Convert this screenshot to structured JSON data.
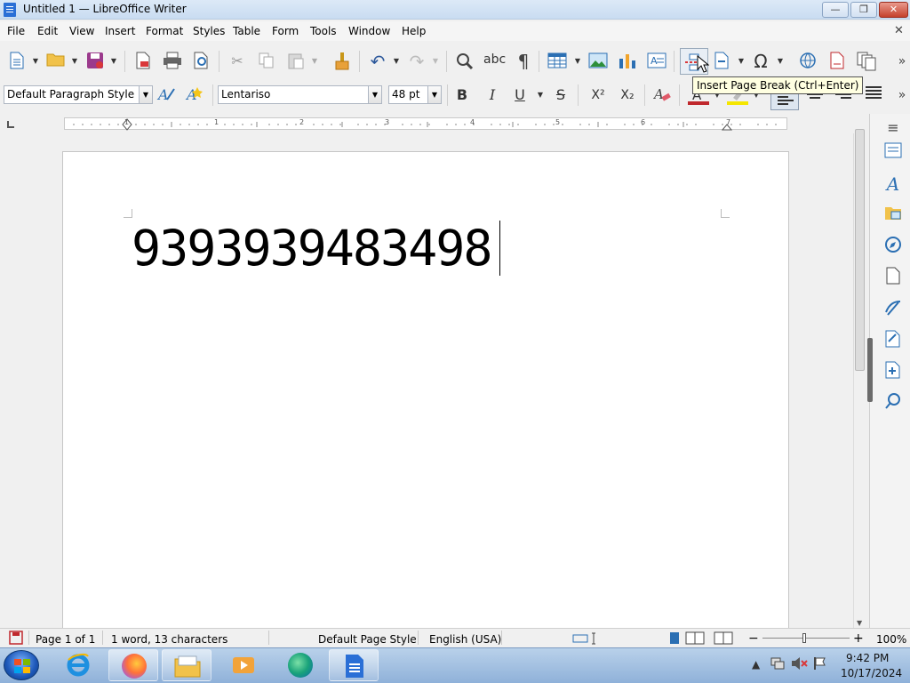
{
  "window": {
    "title": "Untitled 1 — LibreOffice Writer",
    "controls": {
      "minimize": "—",
      "maximize": "❐",
      "close": "✕"
    }
  },
  "menu": {
    "items": [
      "File",
      "Edit",
      "View",
      "Insert",
      "Format",
      "Styles",
      "Table",
      "Form",
      "Tools",
      "Window",
      "Help"
    ],
    "doc_close": "✕"
  },
  "formatting": {
    "paragraph_style": "Default Paragraph Style",
    "font_name": "Lentariso",
    "font_size": "48 pt",
    "bold": "B",
    "italic": "I",
    "underline": "U",
    "strikethrough": "S",
    "superscript": "X²",
    "subscript": "X₂",
    "font_color": "#c0282d",
    "highlight_color": "#f5e600"
  },
  "tooltip": "Insert Page Break (Ctrl+Enter)",
  "ruler": {
    "numbers": [
      "1",
      "1",
      "2",
      "3",
      "4",
      "5",
      "6",
      "7"
    ]
  },
  "document": {
    "text": "9393939483498"
  },
  "statusbar": {
    "page": "Page 1 of 1",
    "words": "1 word, 13 characters",
    "page_style": "Default Page Style",
    "language": "English (USA)",
    "zoom": "100%"
  },
  "taskbar": {
    "time": "9:42 PM",
    "date": "10/17/2024"
  },
  "icons": {
    "toolbar1": [
      "new-document-icon",
      "open-folder-icon",
      "save-icon",
      "export-pdf-icon",
      "print-icon",
      "print-preview-icon",
      "cut-icon",
      "copy-icon",
      "paste-icon",
      "clone-formatting-icon",
      "undo-icon",
      "redo-icon",
      "find-replace-icon",
      "spelling-icon",
      "formatting-marks-icon",
      "insert-table-icon",
      "insert-image-icon",
      "insert-chart-icon",
      "insert-textbox-icon",
      "insert-page-break-icon",
      "insert-field-icon",
      "special-character-icon",
      "hyperlink-icon",
      "footnote-icon",
      "track-changes-icon"
    ],
    "sidebar": [
      "properties-icon",
      "styles-icon",
      "gallery-icon",
      "navigator-icon",
      "page-icon",
      "style-inspector-icon",
      "manage-changes-icon",
      "design-icon",
      "find-icon"
    ]
  }
}
